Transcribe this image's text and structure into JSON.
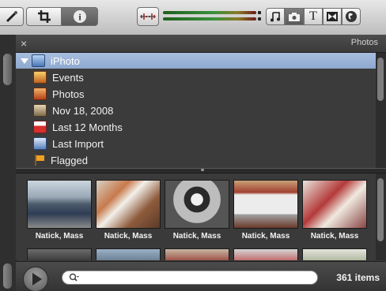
{
  "panel": {
    "title": "Photos",
    "close": "×"
  },
  "source_list": {
    "items": [
      {
        "label": "iPhoto",
        "icon": "iphoto-library-icon",
        "selected": true
      },
      {
        "label": "Events",
        "icon": "events-icon"
      },
      {
        "label": "Photos",
        "icon": "photos-icon"
      },
      {
        "label": "Nov 18, 2008",
        "icon": "album-icon"
      },
      {
        "label": "Last 12 Months",
        "icon": "calendar-icon"
      },
      {
        "label": "Last Import",
        "icon": "last-import-icon"
      },
      {
        "label": "Flagged",
        "icon": "flag-icon"
      }
    ]
  },
  "thumbnails": [
    {
      "label": "Natick, Mass"
    },
    {
      "label": "Natick, Mass"
    },
    {
      "label": "Natick, Mass"
    },
    {
      "label": "Natick, Mass"
    },
    {
      "label": "Natick, Mass"
    }
  ],
  "search": {
    "value": "",
    "placeholder": ""
  },
  "item_count": "361 items",
  "toolbar": {
    "tools": [
      "magic-wand-icon",
      "crop-icon",
      "info-icon",
      "audio-waveform-icon"
    ],
    "media_browsers": [
      "music-icon",
      "camera-icon",
      "title-icon",
      "transition-icon",
      "globe-icon"
    ],
    "info_label": "i",
    "title_label": "T"
  },
  "colors": {
    "selection": "#8ea8cf",
    "panel_bg": "#3b3b3b",
    "meter_green": "#3a913a"
  }
}
